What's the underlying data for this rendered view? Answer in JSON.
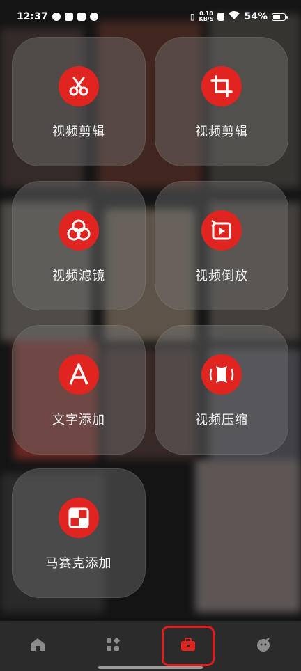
{
  "status_bar": {
    "time": "12:37",
    "net_speed_value": "0.10",
    "net_speed_unit": "KB/S",
    "battery_percent": "54%"
  },
  "tools": [
    {
      "label": "视频剪辑",
      "icon": "scissors-icon"
    },
    {
      "label": "视频剪辑",
      "icon": "crop-icon"
    },
    {
      "label": "视频滤镜",
      "icon": "filter-circles-icon"
    },
    {
      "label": "视频倒放",
      "icon": "reverse-play-icon"
    },
    {
      "label": "文字添加",
      "icon": "letter-a-icon"
    },
    {
      "label": "视频压缩",
      "icon": "compress-icon"
    },
    {
      "label": "马赛克添加",
      "icon": "mosaic-icon"
    }
  ],
  "bottom_nav": [
    {
      "name": "home",
      "icon": "home-icon"
    },
    {
      "name": "apps",
      "icon": "apps-grid-icon"
    },
    {
      "name": "toolbox",
      "icon": "toolbox-icon",
      "selected": true
    },
    {
      "name": "profile",
      "icon": "face-icon"
    }
  ],
  "colors": {
    "accent": "#e0241f",
    "card": "rgba(120,120,120,0.42)",
    "nav_bg": "#2b2b2b",
    "highlight": "#e31b1b"
  }
}
